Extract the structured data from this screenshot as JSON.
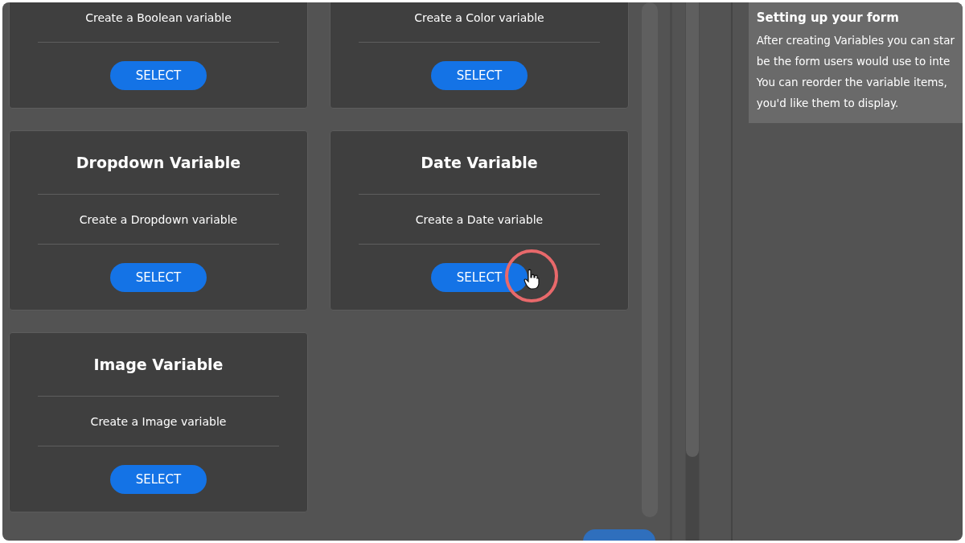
{
  "cards": [
    {
      "description": "Create a Boolean variable",
      "button": "SELECT",
      "clicked": false
    },
    {
      "description": "Create a Color variable",
      "button": "SELECT",
      "clicked": false
    },
    {
      "title": "Dropdown Variable",
      "description": "Create a Dropdown variable",
      "button": "SELECT",
      "clicked": false
    },
    {
      "title": "Date Variable",
      "description": "Create a Date variable",
      "button": "SELECT",
      "clicked": true
    },
    {
      "title": "Image Variable",
      "description": "Create a Image variable",
      "button": "SELECT",
      "clicked": false
    }
  ],
  "tip": {
    "title": "Setting up your form",
    "lines": [
      "After creating Variables you can star",
      "be the form users would use to inte",
      "You can reorder the variable items,",
      "you'd like them to display."
    ]
  }
}
